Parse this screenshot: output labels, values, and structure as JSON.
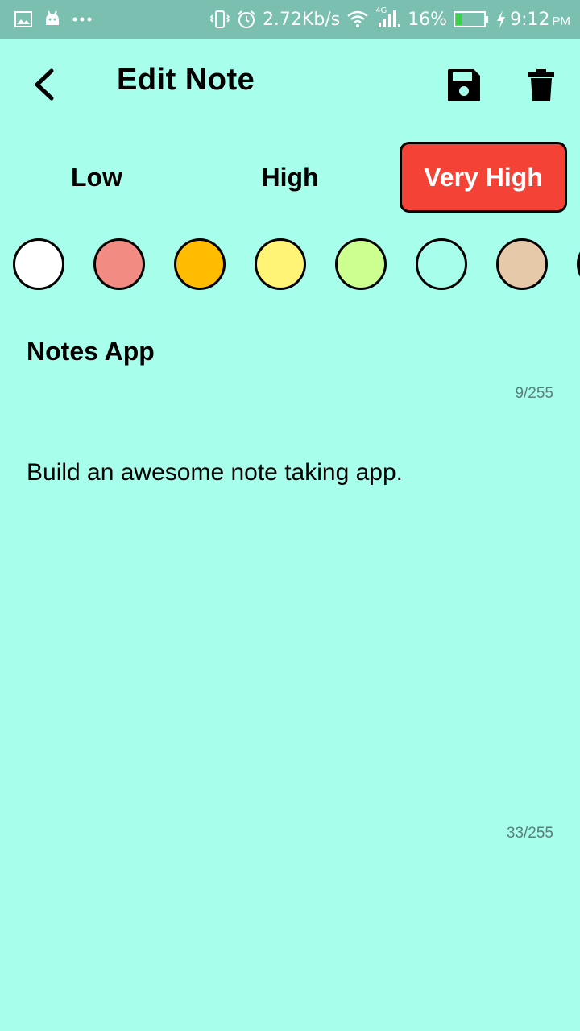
{
  "status_bar": {
    "net_speed": "2.72Kb/s",
    "network_type": "4G",
    "battery": "16%",
    "time": "9:12",
    "ampm": "PM",
    "icons": [
      "gallery-icon",
      "android-icon",
      "more-dots-icon",
      "vibrate-icon",
      "alarm-icon",
      "wifi-icon",
      "signal-icon",
      "battery-icon",
      "charging-icon"
    ]
  },
  "header": {
    "title": "Edit Note",
    "back_icon": "chevron-left-icon",
    "save_icon": "floppy-disk-icon",
    "delete_icon": "trash-icon"
  },
  "priority": {
    "options": [
      "Low",
      "High",
      "Very High"
    ],
    "selected": "Very High",
    "selected_color": "#F44336"
  },
  "colors": {
    "swatches": [
      "#FFFFFF",
      "#F28B82",
      "#FFBC00",
      "#FFF475",
      "#CCFF90",
      "#A7FFEB",
      "#E6C9A8",
      "#000000"
    ],
    "background": "#A7FFEB"
  },
  "note": {
    "title": "Notes App",
    "title_count": "9/255",
    "body": "Build an awesome note taking app.",
    "body_count": "33/255"
  }
}
